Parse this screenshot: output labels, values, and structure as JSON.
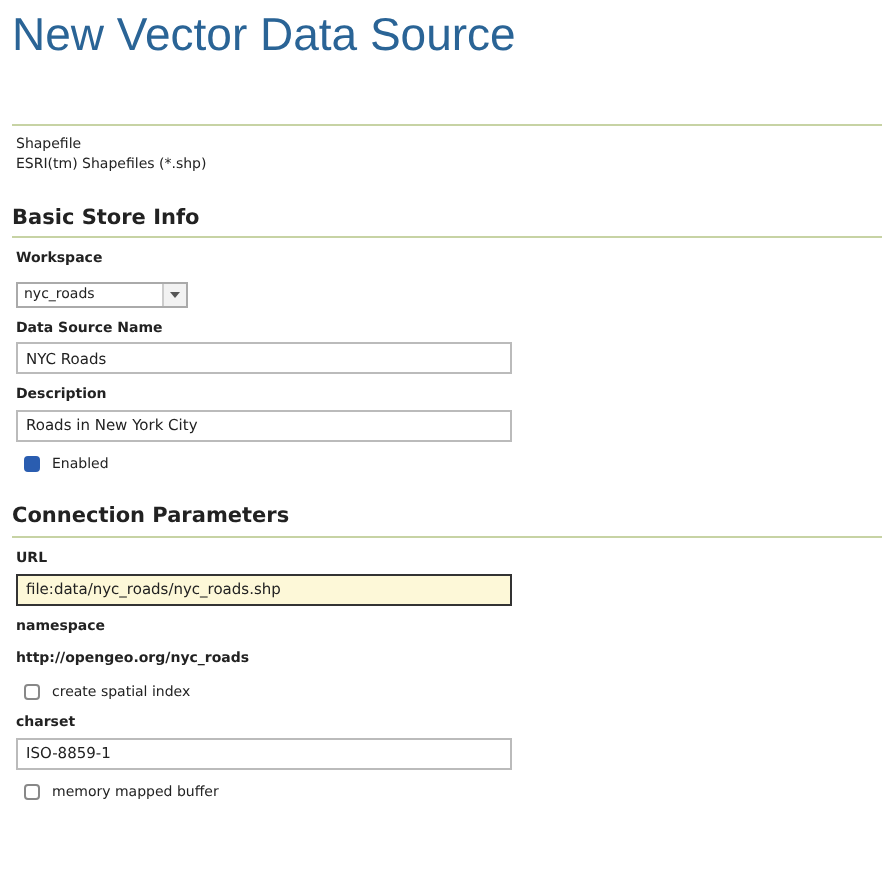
{
  "title": "New Vector Data Source",
  "store_type": {
    "name": "Shapefile",
    "description": "ESRI(tm) Shapefiles (*.shp)"
  },
  "sections": [
    {
      "heading": "Basic Store Info",
      "fields": [
        {
          "kind": "select",
          "label": "Workspace",
          "value": "nyc_roads"
        },
        {
          "kind": "text",
          "label": "Data Source Name",
          "value": "NYC Roads",
          "focused": false
        },
        {
          "kind": "text",
          "label": "Description",
          "value": "Roads in New York City",
          "focused": false
        },
        {
          "kind": "checkbox",
          "label": "Enabled",
          "checked": true
        }
      ]
    },
    {
      "heading": "Connection Parameters",
      "fields": [
        {
          "kind": "text",
          "label": "URL",
          "value": "file:data/nyc_roads/nyc_roads.shp",
          "focused": true
        },
        {
          "kind": "static",
          "label": "namespace",
          "value": "http://opengeo.org/nyc_roads"
        },
        {
          "kind": "checkbox",
          "label": "create spatial index",
          "checked": false
        },
        {
          "kind": "text",
          "label": "charset",
          "value": "ISO-8859-1",
          "focused": false
        },
        {
          "kind": "checkbox",
          "label": "memory mapped buffer",
          "checked": false
        }
      ]
    }
  ]
}
